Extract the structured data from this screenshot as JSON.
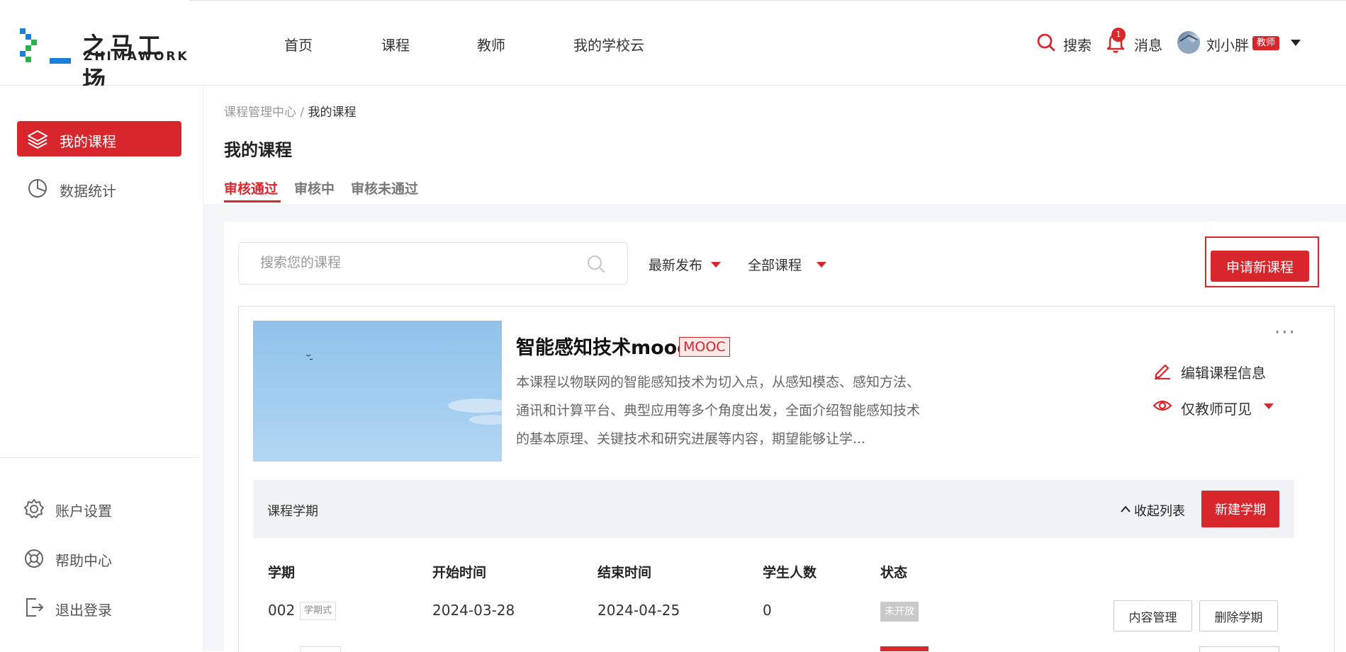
{
  "brand": {
    "logo_cn": "之马工场",
    "logo_en": "ZHIMAWORK"
  },
  "nav": {
    "items": [
      {
        "label": "首页"
      },
      {
        "label": "课程"
      },
      {
        "label": "教师"
      },
      {
        "label": "我的学校云"
      }
    ]
  },
  "header_tools": {
    "search_label": "搜索",
    "message_label": "消息",
    "message_count": "1",
    "user_name": "刘小胖",
    "user_role": "教师"
  },
  "sidebar": {
    "items": [
      {
        "label": "我的课程",
        "icon": "layers-icon"
      },
      {
        "label": "数据统计",
        "icon": "pie-chart-icon"
      }
    ],
    "bottom_items": [
      {
        "label": "账户设置",
        "icon": "gear-icon"
      },
      {
        "label": "帮助中心",
        "icon": "lifebuoy-icon"
      },
      {
        "label": "退出登录",
        "icon": "logout-icon"
      }
    ]
  },
  "breadcrumb": {
    "parent": "课程管理中心",
    "separator": " / ",
    "current": "我的课程"
  },
  "page_title": "我的课程",
  "tabs": [
    {
      "label": "审核通过",
      "active": true
    },
    {
      "label": "审核中"
    },
    {
      "label": "审核未通过"
    }
  ],
  "toolbar": {
    "search_placeholder": "搜索您的课程",
    "sort_label": "最新发布",
    "filter_label": "全部课程",
    "apply_button": "申请新课程"
  },
  "course": {
    "title": "智能感知技术mooc",
    "tag": "MOOC",
    "description": "本课程以物联网的智能感知技术为切入点，从感知模态、感知方法、通讯和计算平台、典型应用等多个角度出发，全面介绍智能感知技术的基本原理、关键技术和研究进展等内容，期望能够让学...",
    "edit_label": "编辑课程信息",
    "visibility_label": "仅教师可见",
    "more_label": "···"
  },
  "semester": {
    "section_label": "课程学期",
    "collapse_label": "收起列表",
    "new_button": "新建学期",
    "columns": [
      "学期",
      "开始时间",
      "结束时间",
      "学生人数",
      "状态"
    ],
    "rows": [
      {
        "term": "002",
        "term_tag": "学期式",
        "start": "2024-03-28",
        "end": "2024-04-25",
        "students": "0",
        "status": "未开放",
        "actions": [
          "内容管理",
          "删除学期"
        ]
      }
    ]
  },
  "colors": {
    "accent": "#d8262d",
    "sidebar_bg": "#ffffff",
    "content_bg": "#f4f5f7"
  }
}
